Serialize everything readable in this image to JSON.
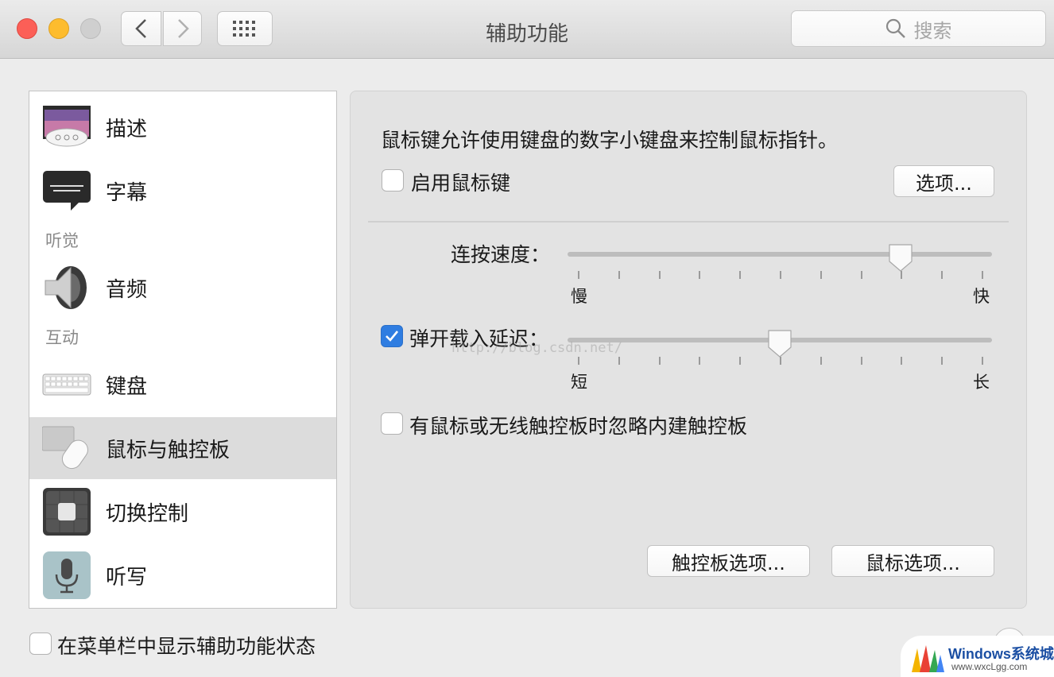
{
  "window": {
    "title": "辅助功能",
    "search_placeholder": "搜索"
  },
  "sidebar": {
    "items": [
      {
        "label": "描述",
        "icon": "description-icon"
      },
      {
        "label": "字幕",
        "icon": "captions-icon"
      },
      {
        "label": "音频",
        "icon": "speaker-icon"
      },
      {
        "label": "键盘",
        "icon": "keyboard-icon"
      },
      {
        "label": "鼠标与触控板",
        "icon": "mouse-trackpad-icon"
      },
      {
        "label": "切换控制",
        "icon": "switch-control-icon"
      },
      {
        "label": "听写",
        "icon": "microphone-icon"
      }
    ],
    "sections": {
      "hearing": "听觉",
      "interaction": "互动"
    },
    "selected": "鼠标与触控板"
  },
  "panel": {
    "description": "鼠标键允许使用键盘的数字小键盘来控制鼠标指针。",
    "enable_mouse_keys": {
      "label": "启用鼠标键",
      "checked": false
    },
    "options_button": "选项...",
    "speed": {
      "label": "连按速度：",
      "min_label": "慢",
      "max_label": "快",
      "value": 0.8
    },
    "delay": {
      "label": "弹开载入延迟：",
      "min_label": "短",
      "max_label": "长",
      "value": 0.5,
      "checked": true
    },
    "ignore_trackpad": {
      "label": "有鼠标或无线触控板时忽略内建触控板",
      "checked": false
    },
    "trackpad_options_button": "触控板选项...",
    "mouse_options_button": "鼠标选项..."
  },
  "footer": {
    "show_status_label": "在菜单栏中显示辅助功能状态",
    "show_status_checked": false,
    "help": "?"
  },
  "overlay": {
    "url_watermark": "http://blog.csdn.net/",
    "logo_brand": "Windows系统城",
    "logo_site": "www.wxcLgg.com"
  },
  "colors": {
    "accent": "#2f7de1",
    "selected_row": "#dcdcdc",
    "close": "#fc5f57",
    "minimize": "#fdbc2e"
  }
}
